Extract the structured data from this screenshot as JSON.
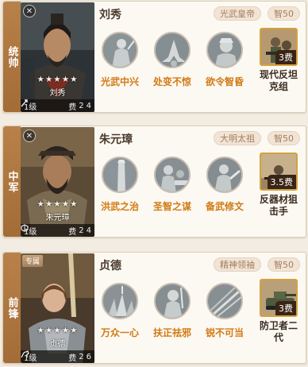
{
  "generals": [
    {
      "position": "统帅",
      "name": "刘秀",
      "title_tag": "光武皇帝",
      "stat_tag": "智50",
      "portrait_name": "刘秀",
      "stars": "★★★★★",
      "level": "1级",
      "cost_label": "费",
      "cost": "2",
      "troop": "4",
      "corner_tag": "",
      "skills": [
        {
          "name": "光武中兴"
        },
        {
          "name": "处变不惊"
        },
        {
          "name": "欲令智昏"
        }
      ],
      "item": {
        "cost": "3费",
        "name": "现代反坦克组"
      }
    },
    {
      "position": "中军",
      "name": "朱元璋",
      "title_tag": "大明太祖",
      "stat_tag": "智50",
      "portrait_name": "朱元璋",
      "stars": "★★★★★",
      "level": "1级",
      "cost_label": "费",
      "cost": "2",
      "troop": "4",
      "corner_tag": "",
      "skills": [
        {
          "name": "洪武之治"
        },
        {
          "name": "圣智之谋"
        },
        {
          "name": "备武修文"
        }
      ],
      "item": {
        "cost": "3.5费",
        "name": "反器材狙击手"
      }
    },
    {
      "position": "前锋",
      "name": "贞德",
      "title_tag": "精神领袖",
      "stat_tag": "智50",
      "portrait_name": "贞德",
      "stars": "★★★★★",
      "level": "1级",
      "cost_label": "费",
      "cost": "2",
      "troop": "6",
      "corner_tag": "专属",
      "skills": [
        {
          "name": "万众一心"
        },
        {
          "name": "扶正祛邪"
        },
        {
          "name": "锐不可当"
        }
      ],
      "item": {
        "cost": "3费",
        "name": "防卫者二代"
      }
    }
  ]
}
